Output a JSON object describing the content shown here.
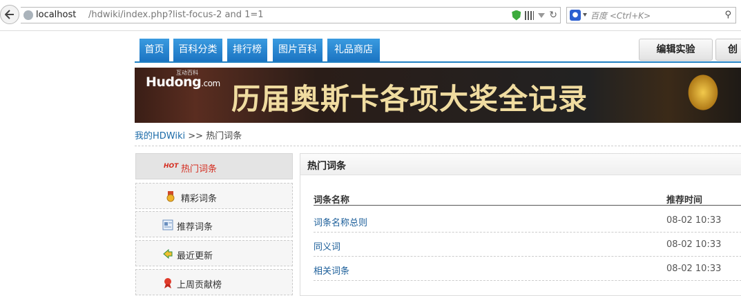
{
  "browser": {
    "url_host": "localhost",
    "url_path": "/hdwiki/index.php?list-focus-2 and 1=1",
    "search_engine": "百度",
    "search_placeholder": "百度 <Ctrl+K>"
  },
  "nav": {
    "tabs": [
      "首页",
      "百科分类",
      "排行榜",
      "图片百科",
      "礼品商店"
    ],
    "right_buttons": [
      "编辑实验",
      "创"
    ]
  },
  "banner": {
    "logo_text": "Hudong",
    "logo_suffix": ".com",
    "logo_cn": "互动百科",
    "title": "历届奥斯卡各项大奖全记录"
  },
  "breadcrumb": {
    "home": "我的HDWiki",
    "separator": ">>",
    "current": "热门词条"
  },
  "sidebar": {
    "items": [
      {
        "label": "热门词条",
        "badge": "HOT",
        "active": true
      },
      {
        "label": "精彩词条",
        "icon": "medal-icon",
        "active": false
      },
      {
        "label": "推荐词条",
        "icon": "document-icon",
        "active": false
      },
      {
        "label": "最近更新",
        "icon": "update-icon",
        "active": false
      },
      {
        "label": "上周贡献榜",
        "icon": "ribbon-icon",
        "active": false
      }
    ]
  },
  "main": {
    "title": "热门词条",
    "columns": [
      "词条名称",
      "推荐时间"
    ],
    "rows": [
      {
        "name": "词条名称总则",
        "time": "08-02 10:33"
      },
      {
        "name": "同义词",
        "time": "08-02 10:33"
      },
      {
        "name": "相关词条",
        "time": "08-02 10:33"
      }
    ]
  },
  "colors": {
    "tab_blue": "#1b74c2",
    "link_blue": "#1a6aa8",
    "active_red": "#d42b1e"
  }
}
